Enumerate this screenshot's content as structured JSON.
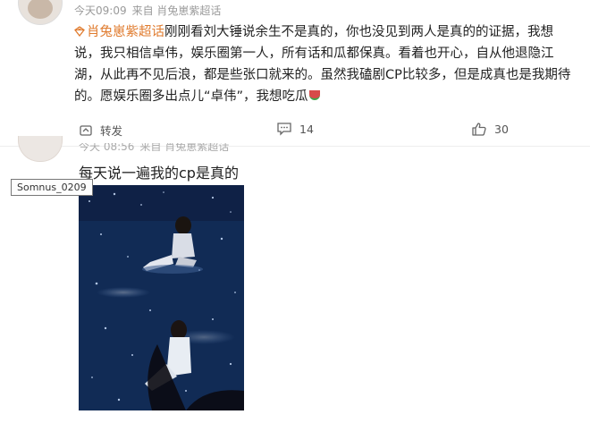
{
  "post1": {
    "timestamp": "今天09:09",
    "source": "来自 肖兔崽紫超话",
    "topic": "肖兔崽紫超话",
    "text": "刚刚看刘大锤说余生不是真的，你也没见到两人是真的的证据，我想说，我只相信卓伟，娱乐圈第一人，所有话和瓜都保真。看着也开心，自从他退隐江湖，从此再不见后浪，都是些张口就来的。虽然我磕剧CP比较多，但是成真也是我期待的。愿娱乐圈多出点儿“卓伟”，我想吃瓜",
    "repost_label": "转发",
    "comment_count": "14",
    "like_count": "30"
  },
  "post2": {
    "timestamp": "今天 08:56",
    "source": "来自 肖兔崽紫超话",
    "text": "每天说一遍我的cp是真的",
    "username_tooltip": "Somnus_0209"
  },
  "colors": {
    "topic": "#e07b2e",
    "text": "#222222",
    "meta": "#9a9a9a"
  }
}
